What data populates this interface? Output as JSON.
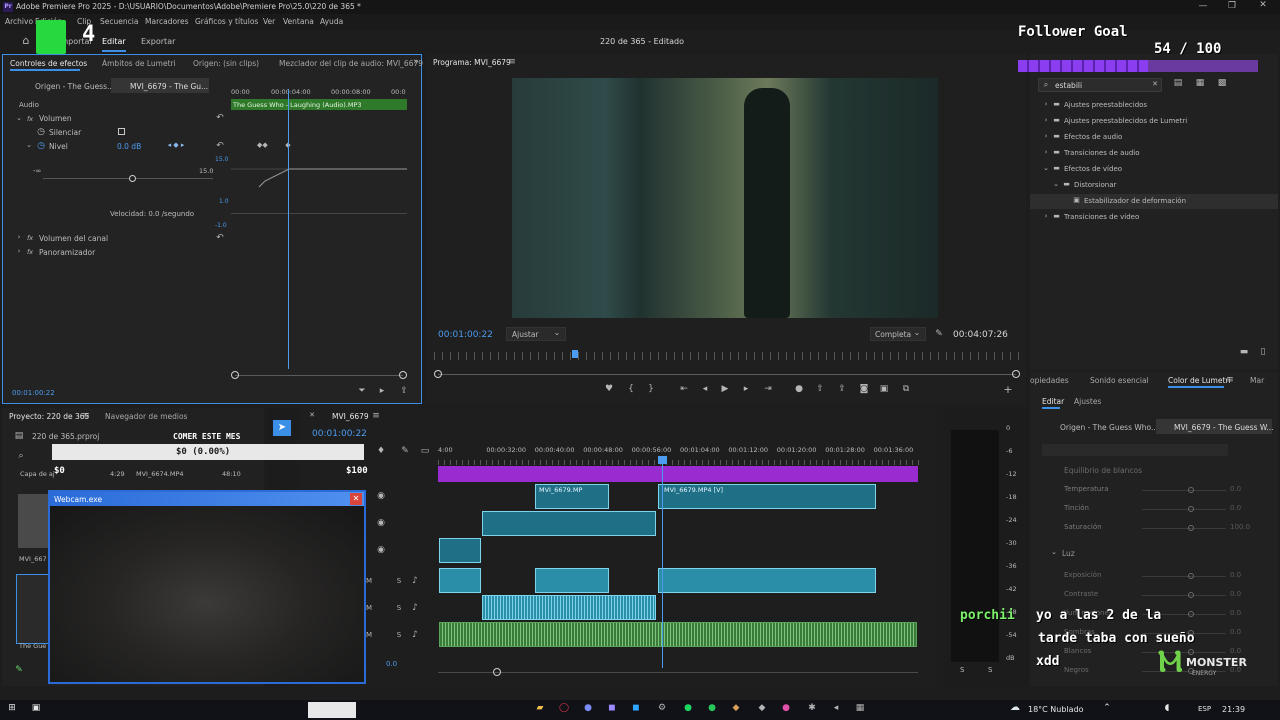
{
  "window": {
    "app_icon": "Pr",
    "title": "Adobe Premiere Pro 2025 - D:\\USUARIO\\Documentos\\Adobe\\Premiere Pro\\25.0\\220 de 365 *",
    "menu": [
      "Archivo",
      "Edición",
      "Clip",
      "Secuencia",
      "Marcadores",
      "Gráficos y títulos",
      "Ver",
      "Ventana",
      "Ayuda"
    ]
  },
  "header": {
    "workspace_tabs": [
      "Importar",
      "Editar",
      "Exportar"
    ],
    "project_title": "220 de 365 - Editado"
  },
  "effect_controls": {
    "tabs": [
      "Controles de efectos",
      "Ámbitos de Lumetri",
      "Origen: (sin clips)",
      "Mezclador del clip de audio: MVI_6679"
    ],
    "source_clip": "Origen - The Guess...",
    "seq_clip": "MVI_6679 - The Gu...",
    "ruler": [
      "00:00",
      "00:00:04:00",
      "00:00:08:00",
      "00:0"
    ],
    "clip_bar": "The Guess Who - Laughing (Audio).MP3",
    "section": "Audio",
    "volume": "Volumen",
    "bypass": "Silenciar",
    "level_label": "Nivel",
    "level_value": "0.0 dB",
    "level_max": "15.0",
    "level_graph_top": "15.0",
    "level_min": "-∞",
    "velocity_label": "Velocidad: 0.0 /segundo",
    "vel_top": "1.0",
    "vel_bottom": "-1.0",
    "channel_volume": "Volumen del canal",
    "panner": "Panoramizador",
    "timecode": "00:01:00:22"
  },
  "program": {
    "tab": "Programa: MVI_6679",
    "timecode": "00:01:00:22",
    "fit": "Ajustar",
    "quality": "Completa",
    "duration": "00:04:07:26"
  },
  "effects": {
    "search": "estabili",
    "tree": [
      {
        "label": "Ajustes preestablecidos",
        "level": 0,
        "open": false
      },
      {
        "label": "Ajustes preestablecidos de Lumetri",
        "level": 0,
        "open": false
      },
      {
        "label": "Efectos de audio",
        "level": 0,
        "open": false
      },
      {
        "label": "Transiciones de audio",
        "level": 0,
        "open": false
      },
      {
        "label": "Efectos de vídeo",
        "level": 0,
        "open": true
      },
      {
        "label": "Distorsionar",
        "level": 1,
        "open": true
      },
      {
        "label": "Estabilizador de deformación",
        "level": 2,
        "open": false
      },
      {
        "label": "Transiciones de vídeo",
        "level": 0,
        "open": false
      }
    ]
  },
  "lumetri": {
    "tabs": [
      "opiedades",
      "Sonido esencial",
      "Color de Lumetri",
      "Mar"
    ],
    "subtabs": [
      "Editar",
      "Ajustes"
    ],
    "source_clip": "Origen - The Guess Who...",
    "seq_clip": "MVI_6679 - The Guess W...",
    "white_balance": "Equilibrio de blancos",
    "rows": [
      {
        "label": "Temperatura",
        "value": "0.0"
      },
      {
        "label": "Tinción",
        "value": "0.0"
      },
      {
        "label": "Saturación",
        "value": "100.0"
      }
    ],
    "light": "Luz",
    "light_rows": [
      {
        "label": "Exposición",
        "value": "0.0"
      },
      {
        "label": "Contraste",
        "value": "0.0"
      },
      {
        "label": "Iluminaciones",
        "value": "0.0"
      },
      {
        "label": "Sombras",
        "value": "0.0"
      },
      {
        "label": "Blancos",
        "value": "0.0"
      },
      {
        "label": "Negros",
        "value": "0.0"
      }
    ]
  },
  "project": {
    "tabs": [
      "Proyecto: 220 de 365",
      "Navegador de medios"
    ],
    "file": "220 de 365.prproj",
    "col_name": "Capa de aj",
    "rows": [
      {
        "dur": "4:29",
        "name": "MVI_6674.MP4",
        "dur2": "48:10"
      }
    ],
    "thumb1": "MVI_667",
    "thumb2": "The Gue"
  },
  "timeline": {
    "tab": "MVI_6679",
    "timecode": "00:01:00:22",
    "ruler": [
      "4:00",
      "00:00:32:00",
      "00:00:40:00",
      "00:00:48:00",
      "00:00:56:00",
      "00:01:04:00",
      "00:01:12:00",
      "00:01:20:00",
      "00:01:28:00",
      "00:01:36:00"
    ],
    "clip1": "MVI_6679.MP",
    "clip2": "MVI_6679.MP4 [V]",
    "footer_value": "0.0"
  },
  "meters": [
    "0",
    "-6",
    "-12",
    "-18",
    "-24",
    "-30",
    "-36",
    "-42",
    "-48",
    "-54",
    "dB"
  ],
  "meter_bottom": [
    "S",
    "S"
  ],
  "overlays": {
    "follower_title": "Follower Goal",
    "follower_count": "54 / 100",
    "donation_title": "COMER ESTE MES",
    "donation_amount": "$0 (0.00%)",
    "donation_start": "$0",
    "donation_end": "$100",
    "webcam_title": "Webcam.exe",
    "chat_user": "porchii",
    "chat_message_1": "yo a las 2 de la",
    "chat_message_2": "tarde taba con sueño",
    "chat_message_3": "xdd",
    "sponsor": "MONSTER",
    "sponsor_sub": "ENERGY",
    "streamer_badge": "4"
  },
  "taskbar": {
    "weather": "18°C  Nublado",
    "lang": "ESP",
    "time": "21:39"
  },
  "colors": {
    "accent": "#3b8fe6",
    "timeline_purple": "#9a2bd1",
    "clip_blue": "#1f6f86",
    "audio_green": "#3a7b3a",
    "follower_bar": "#7b2fd6",
    "chat_user": "#7bf26a"
  }
}
